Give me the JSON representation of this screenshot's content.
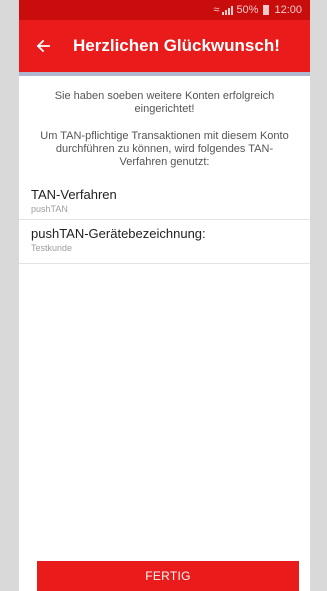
{
  "status_bar": {
    "wifi_icon": "wifi-icon",
    "battery_percent": "50%",
    "time": "12:00"
  },
  "app_bar": {
    "back_icon": "arrow-left-icon",
    "title": "Herzlichen Glückwunsch!"
  },
  "main": {
    "message_1": "Sie haben soeben weitere Konten erfolgreich eingerichtet!",
    "message_2": "Um TAN-pflichtige Transaktionen mit diesem Konto durchführen zu können, wird folgendes TAN-Verfahren genutzt:",
    "fields": [
      {
        "label": "TAN-Verfahren",
        "value": "pushTAN"
      },
      {
        "label": "pushTAN-Gerätebezeichnung:",
        "value": "Testkunde"
      }
    ]
  },
  "footer": {
    "done_label": "FERTIG"
  },
  "colors": {
    "primary": "#ea1b1b",
    "status_bar": "#c90d0d"
  }
}
